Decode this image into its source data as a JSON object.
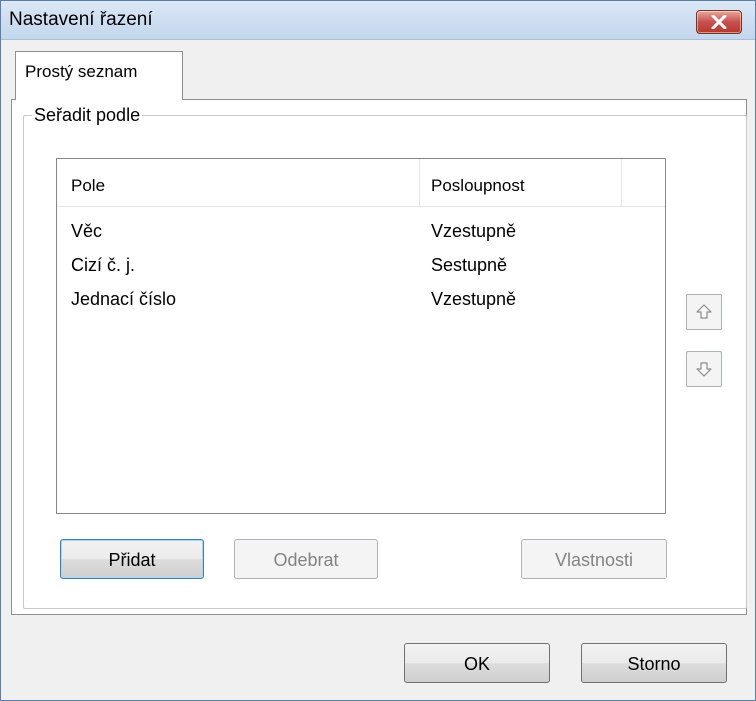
{
  "window": {
    "title": "Nastavení řazení"
  },
  "tabs": [
    {
      "label": "Prostý seznam",
      "active": true
    }
  ],
  "group": {
    "label": "Seřadit podle"
  },
  "list": {
    "columns": [
      "Pole",
      "Posloupnost"
    ],
    "rows": [
      {
        "field": "Věc",
        "order": "Vzestupně"
      },
      {
        "field": "Cizí č. j.",
        "order": "Sestupně"
      },
      {
        "field": "Jednací číslo",
        "order": "Vzestupně"
      }
    ]
  },
  "buttons": {
    "add": "Přidat",
    "remove": "Odebrat",
    "properties": "Vlastnosti",
    "ok": "OK",
    "cancel": "Storno"
  },
  "icons": {
    "close": "close-icon",
    "move_up": "arrow-up-icon",
    "move_down": "arrow-down-icon"
  },
  "colors": {
    "titlebar": "#c3d6ec",
    "close_button": "#c75050",
    "panel": "#f0f0f0"
  }
}
